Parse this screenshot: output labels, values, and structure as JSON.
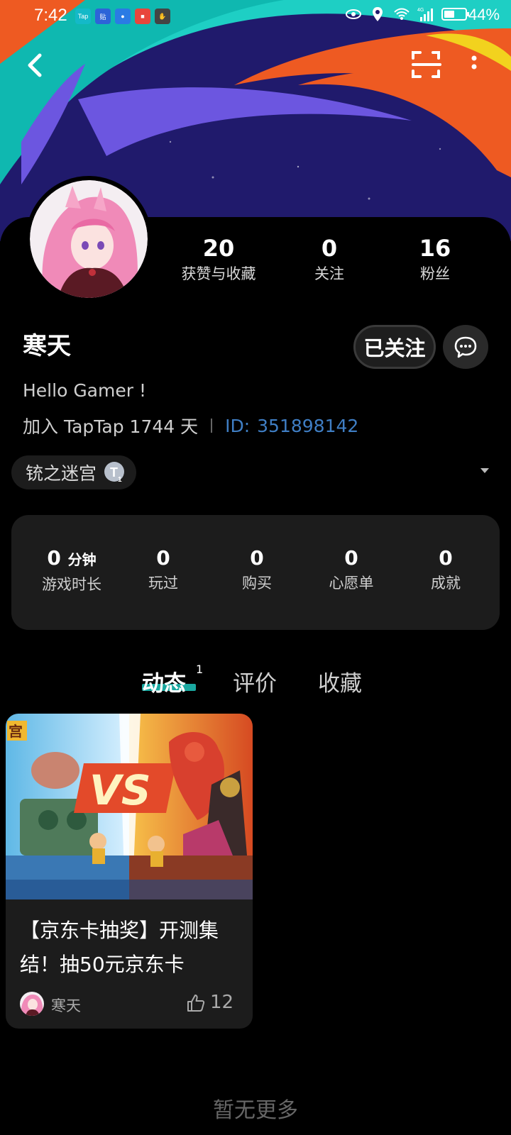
{
  "status_bar": {
    "time": "7:42",
    "battery": "44%",
    "notification_icons": [
      "taptap-app-icon",
      "tieba-app-icon",
      "bulb-app-icon",
      "shopping-app-icon",
      "hand-app-icon"
    ],
    "network_label": "4G"
  },
  "header": {
    "back_icon": "back-arrow-icon",
    "scan_icon": "scan-icon",
    "more_icon": "more-vertical-icon"
  },
  "profile": {
    "username": "寒天",
    "bio": "Hello Gamer !",
    "join_text": "加入 TapTap 1744 天",
    "id_label": "ID:",
    "id_value": "351898142",
    "follow_button": "已关注",
    "message_icon": "message-icon"
  },
  "stats": [
    {
      "value": "20",
      "label": "获赞与收藏"
    },
    {
      "value": "0",
      "label": "关注"
    },
    {
      "value": "16",
      "label": "粉丝"
    }
  ],
  "game_tag": {
    "label": "铳之迷宫",
    "badge": "T",
    "badge_count": "1"
  },
  "play_stats": [
    {
      "value": "0",
      "unit": "分钟",
      "label": "游戏时长"
    },
    {
      "value": "0",
      "unit": "",
      "label": "玩过"
    },
    {
      "value": "0",
      "unit": "",
      "label": "购买"
    },
    {
      "value": "0",
      "unit": "",
      "label": "心愿单"
    },
    {
      "value": "0",
      "unit": "",
      "label": "成就"
    }
  ],
  "tabs": [
    {
      "label": "动态",
      "count": "1",
      "active": true
    },
    {
      "label": "评价"
    },
    {
      "label": "收藏"
    }
  ],
  "post": {
    "image_text": "VS",
    "corner_text": "宫",
    "title": "【京东卡抽奖】开测集结！抽50元京东卡",
    "author": "寒天",
    "likes": "12"
  },
  "footer": {
    "no_more": "暂无更多"
  },
  "colors": {
    "accent_teal": "#1aa8a0",
    "id_blue": "#3f7ec4",
    "card_bg": "#1c1c1c",
    "header_navy": "#201a6c",
    "header_orange": "#ee5a22"
  }
}
